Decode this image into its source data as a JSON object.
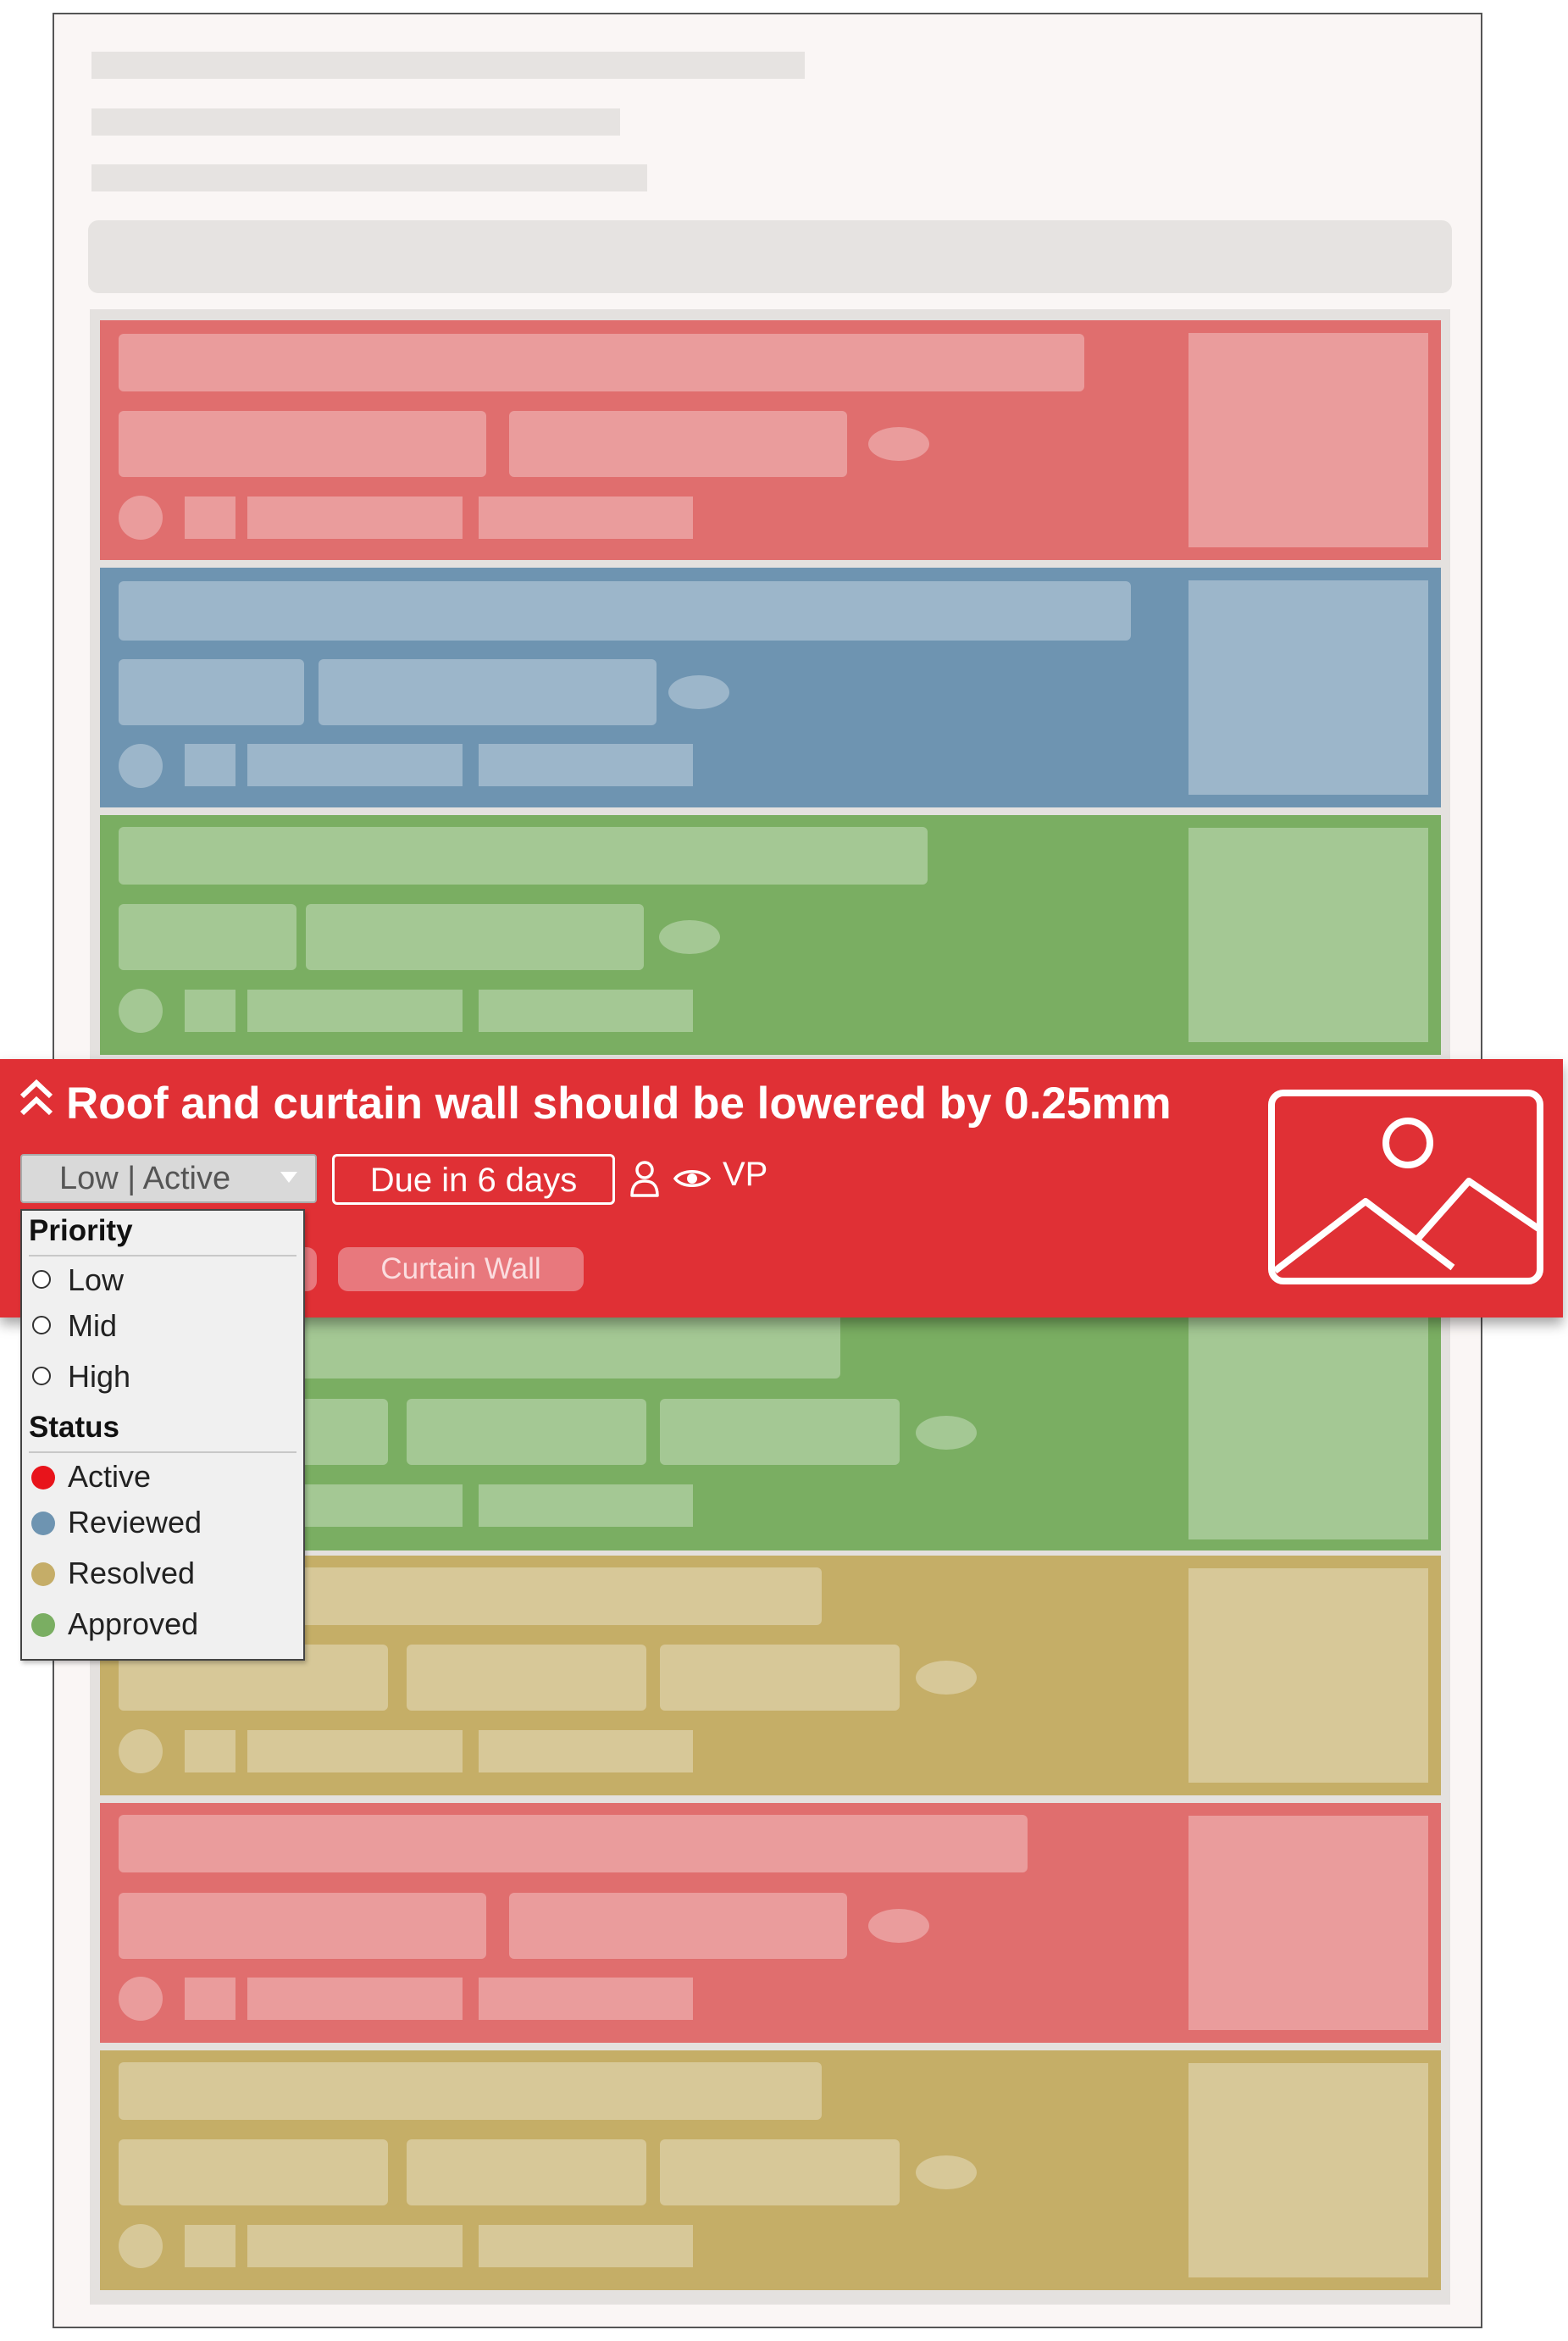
{
  "issue": {
    "title": "Roof and curtain wall should be lowered by 0.25mm",
    "status_select_value": "Low | Active",
    "due_label": "Due in 6 days",
    "assignee_initials": "VP",
    "tag_label": "Curtain Wall"
  },
  "dropdown": {
    "priority_heading": "Priority",
    "priority_options": [
      "Low",
      "Mid",
      "High"
    ],
    "status_heading": "Status",
    "status_options": [
      {
        "label": "Active",
        "color": "#e8141b"
      },
      {
        "label": "Reviewed",
        "color": "#6e94b1"
      },
      {
        "label": "Resolved",
        "color": "#c5ad68"
      },
      {
        "label": "Approved",
        "color": "#7aae62"
      }
    ]
  },
  "colors": {
    "active": "#e06e6e",
    "reviewed": "#6e94b1",
    "approved": "#7aae62",
    "resolved": "#c5ae67",
    "focus": "#e03035"
  },
  "icons": [
    "priority-chevron-icon",
    "dropdown-caret-icon",
    "person-icon",
    "eye-icon",
    "image-placeholder-icon"
  ]
}
